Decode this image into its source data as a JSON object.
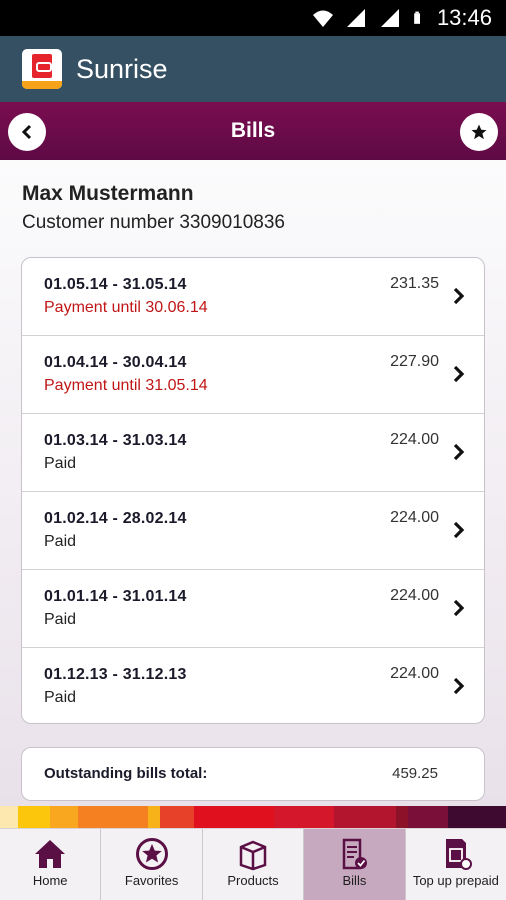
{
  "status_bar": {
    "time": "13:46",
    "icons": [
      "wifi-icon",
      "signal-icon",
      "signal-icon",
      "battery-icon"
    ]
  },
  "app_bar": {
    "title": "Sunrise"
  },
  "sub_header": {
    "title": "Bills",
    "back_icon": "chevron-left-icon",
    "favorite_icon": "star-icon"
  },
  "customer": {
    "name": "Max Mustermann",
    "number_text": "Customer number 3309010836"
  },
  "bills": [
    {
      "period": "01.05.14 - 31.05.14",
      "amount": "231.35",
      "status": "Payment until 30.06.14",
      "status_type": "due"
    },
    {
      "period": "01.04.14 - 30.04.14",
      "amount": "227.90",
      "status": "Payment until 31.05.14",
      "status_type": "due"
    },
    {
      "period": "01.03.14 - 31.03.14",
      "amount": "224.00",
      "status": "Paid",
      "status_type": "paid"
    },
    {
      "period": "01.02.14 - 28.02.14",
      "amount": "224.00",
      "status": "Paid",
      "status_type": "paid"
    },
    {
      "period": "01.01.14 - 31.01.14",
      "amount": "224.00",
      "status": "Paid",
      "status_type": "paid"
    },
    {
      "period": "01.12.13 - 31.12.13",
      "amount": "224.00",
      "status": "Paid",
      "status_type": "paid"
    }
  ],
  "total": {
    "label": "Outstanding bills total:",
    "value": "459.25"
  },
  "bottom_nav": [
    {
      "label": "Home",
      "icon": "home-icon",
      "active": false
    },
    {
      "label": "Favorites",
      "icon": "star-icon",
      "active": false
    },
    {
      "label": "Products",
      "icon": "box-icon",
      "active": false
    },
    {
      "label": "Bills",
      "icon": "bill-icon",
      "active": true
    },
    {
      "label": "Top up prepaid",
      "icon": "sim-card-icon",
      "active": false
    }
  ],
  "colors": {
    "action_bar": "#355063",
    "header_purple": "#6d0c4b",
    "due_red": "#c01616",
    "nav_active": "#c6a9bf",
    "icon_purple": "#5a0f45"
  }
}
